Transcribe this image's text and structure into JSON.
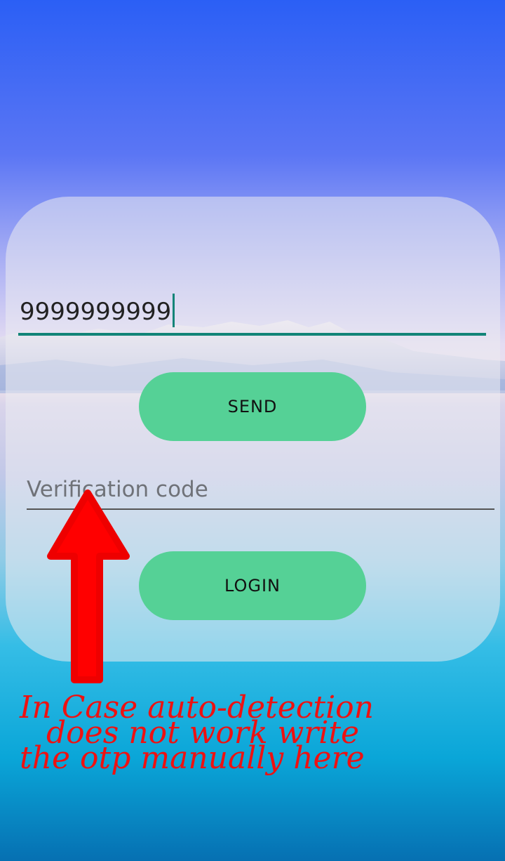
{
  "login": {
    "phone_value": "9999999999",
    "send_label": "SEND",
    "code_placeholder": "Verification code",
    "login_label": "LOGIN"
  },
  "annotation": {
    "lines": [
      "In Case auto-detection",
      "does not work write",
      "the otp manually here"
    ],
    "color": "#ee1111"
  },
  "colors": {
    "accent": "#128478",
    "button": "#55d196"
  }
}
